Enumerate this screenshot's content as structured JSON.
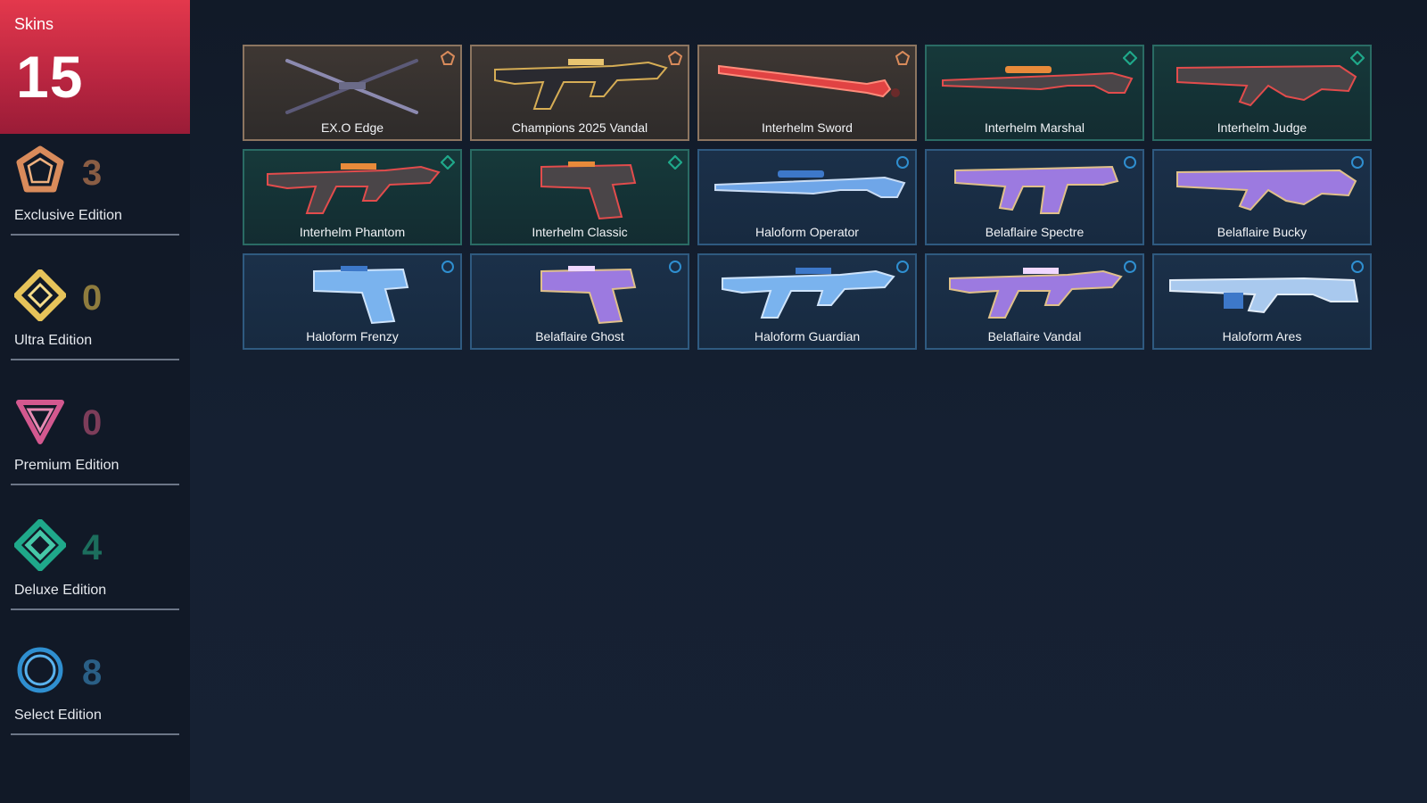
{
  "colors": {
    "exclusive": "#d98b5b",
    "ultra": "#e6c35a",
    "premium": "#d3588f",
    "deluxe": "#1fa88a",
    "select": "#2f8fd0",
    "total_panel": "#c72b43"
  },
  "summary": {
    "title": "Skins",
    "count": "15"
  },
  "tiers": [
    {
      "id": "exclusive",
      "icon": "exclusive-edition-icon",
      "count": "3",
      "label": "Exclusive Edition"
    },
    {
      "id": "ultra",
      "icon": "ultra-edition-icon",
      "count": "0",
      "label": "Ultra Edition"
    },
    {
      "id": "premium",
      "icon": "premium-edition-icon",
      "count": "0",
      "label": "Premium Edition"
    },
    {
      "id": "deluxe",
      "icon": "deluxe-edition-icon",
      "count": "4",
      "label": "Deluxe Edition"
    },
    {
      "id": "select",
      "icon": "select-edition-icon",
      "count": "8",
      "label": "Select Edition"
    }
  ],
  "skins": [
    {
      "name": "EX.O Edge",
      "tier": "exclusive",
      "kind": "melee-blades"
    },
    {
      "name": "Champions 2025 Vandal",
      "tier": "exclusive",
      "kind": "rifle"
    },
    {
      "name": "Interhelm Sword",
      "tier": "exclusive",
      "kind": "sword"
    },
    {
      "name": "Interhelm Marshal",
      "tier": "deluxe",
      "kind": "sniper"
    },
    {
      "name": "Interhelm Judge",
      "tier": "deluxe",
      "kind": "shotgun"
    },
    {
      "name": "Interhelm Phantom",
      "tier": "deluxe",
      "kind": "rifle"
    },
    {
      "name": "Interhelm Classic",
      "tier": "deluxe",
      "kind": "pistol"
    },
    {
      "name": "Haloform Operator",
      "tier": "select",
      "kind": "sniper"
    },
    {
      "name": "Belaflaire Spectre",
      "tier": "select",
      "kind": "smg"
    },
    {
      "name": "Belaflaire Bucky",
      "tier": "select",
      "kind": "shotgun"
    },
    {
      "name": "Haloform Frenzy",
      "tier": "select",
      "kind": "pistol"
    },
    {
      "name": "Belaflaire Ghost",
      "tier": "select",
      "kind": "pistol"
    },
    {
      "name": "Haloform Guardian",
      "tier": "select",
      "kind": "rifle"
    },
    {
      "name": "Belaflaire Vandal",
      "tier": "select",
      "kind": "rifle"
    },
    {
      "name": "Haloform Ares",
      "tier": "select",
      "kind": "lmg"
    }
  ]
}
